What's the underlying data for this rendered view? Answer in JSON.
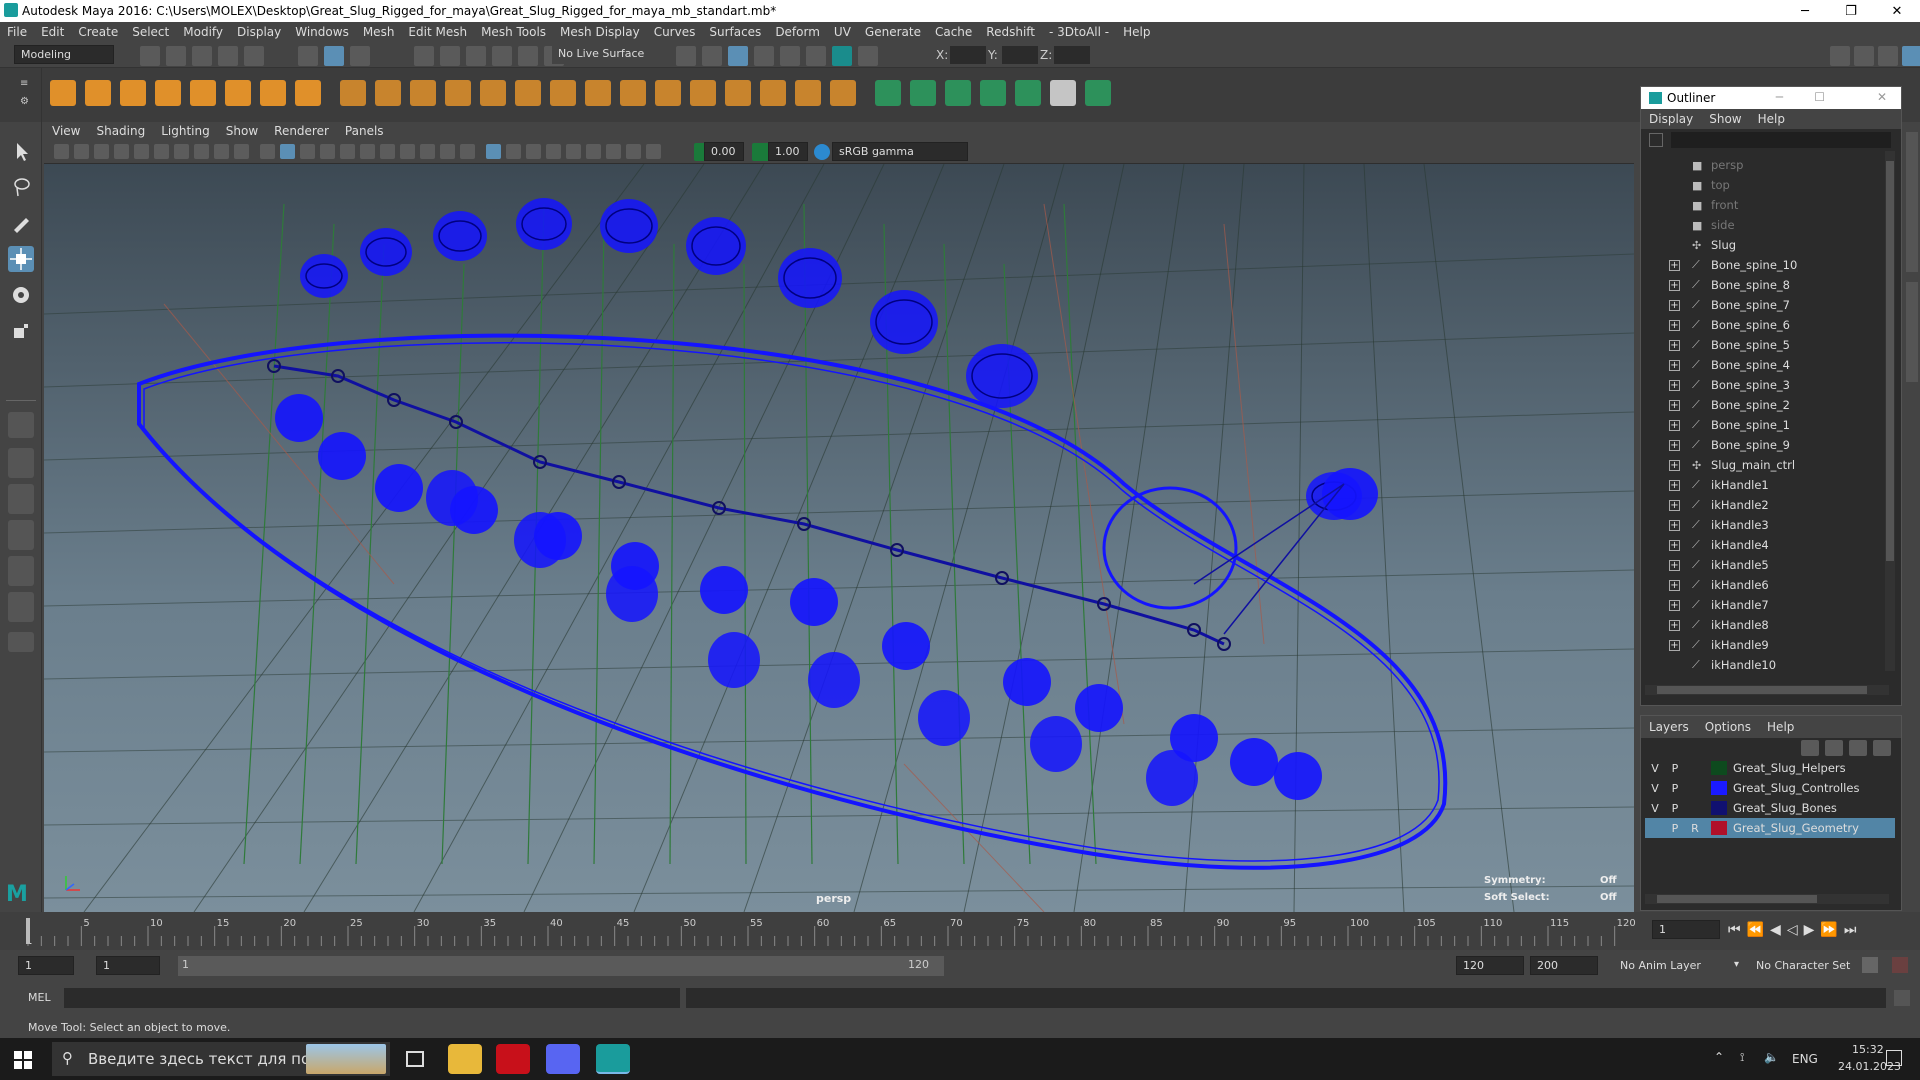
{
  "window": {
    "title": "Autodesk Maya 2016: C:\\Users\\MOLEX\\Desktop\\Great_Slug_Rigged_for_maya\\Great_Slug_Rigged_for_maya_mb_standart.mb*"
  },
  "menubar": [
    "File",
    "Edit",
    "Create",
    "Select",
    "Modify",
    "Display",
    "Windows",
    "Mesh",
    "Edit Mesh",
    "Mesh Tools",
    "Mesh Display",
    "Curves",
    "Surfaces",
    "Deform",
    "UV",
    "Generate",
    "Cache",
    "Redshift",
    "- 3DtoAll -",
    "Help"
  ],
  "statusline": {
    "mode": "Modeling",
    "live_surface": "No Live Surface",
    "x_label": "X:",
    "y_label": "Y:",
    "z_label": "Z:"
  },
  "viewport": {
    "menu": [
      "View",
      "Shading",
      "Lighting",
      "Show",
      "Renderer",
      "Panels"
    ],
    "near": "0.00",
    "far": "1.00",
    "colorspace": "sRGB gamma",
    "camera": "persp",
    "hud": [
      {
        "label": "Symmetry:",
        "value": "Off"
      },
      {
        "label": "Soft Select:",
        "value": "Off"
      }
    ],
    "wire_color": "#1414ff"
  },
  "outliner": {
    "title": "Outliner",
    "menu": [
      "Display",
      "Show",
      "Help"
    ],
    "items": [
      {
        "label": "persp",
        "icon": "camera-icon",
        "expand": false,
        "dim": true
      },
      {
        "label": "top",
        "icon": "camera-icon",
        "expand": false,
        "dim": true
      },
      {
        "label": "front",
        "icon": "camera-icon",
        "expand": false,
        "dim": true
      },
      {
        "label": "side",
        "icon": "camera-icon",
        "expand": false,
        "dim": true
      },
      {
        "label": "Slug",
        "icon": "transform-icon",
        "expand": false,
        "dim": false
      },
      {
        "label": "Bone_spine_10",
        "icon": "joint-icon",
        "expand": true,
        "dim": false
      },
      {
        "label": "Bone_spine_8",
        "icon": "joint-icon",
        "expand": true,
        "dim": false
      },
      {
        "label": "Bone_spine_7",
        "icon": "joint-icon",
        "expand": true,
        "dim": false
      },
      {
        "label": "Bone_spine_6",
        "icon": "joint-icon",
        "expand": true,
        "dim": false
      },
      {
        "label": "Bone_spine_5",
        "icon": "joint-icon",
        "expand": true,
        "dim": false
      },
      {
        "label": "Bone_spine_4",
        "icon": "joint-icon",
        "expand": true,
        "dim": false
      },
      {
        "label": "Bone_spine_3",
        "icon": "joint-icon",
        "expand": true,
        "dim": false
      },
      {
        "label": "Bone_spine_2",
        "icon": "joint-icon",
        "expand": true,
        "dim": false
      },
      {
        "label": "Bone_spine_1",
        "icon": "joint-icon",
        "expand": true,
        "dim": false
      },
      {
        "label": "Bone_spine_9",
        "icon": "joint-icon",
        "expand": true,
        "dim": false
      },
      {
        "label": "Slug_main_ctrl",
        "icon": "transform-icon",
        "expand": true,
        "dim": false
      },
      {
        "label": "ikHandle1",
        "icon": "ik-icon",
        "expand": true,
        "dim": false
      },
      {
        "label": "ikHandle2",
        "icon": "ik-icon",
        "expand": true,
        "dim": false
      },
      {
        "label": "ikHandle3",
        "icon": "ik-icon",
        "expand": true,
        "dim": false
      },
      {
        "label": "ikHandle4",
        "icon": "ik-icon",
        "expand": true,
        "dim": false
      },
      {
        "label": "ikHandle5",
        "icon": "ik-icon",
        "expand": true,
        "dim": false
      },
      {
        "label": "ikHandle6",
        "icon": "ik-icon",
        "expand": true,
        "dim": false
      },
      {
        "label": "ikHandle7",
        "icon": "ik-icon",
        "expand": true,
        "dim": false
      },
      {
        "label": "ikHandle8",
        "icon": "ik-icon",
        "expand": true,
        "dim": false
      },
      {
        "label": "ikHandle9",
        "icon": "ik-icon",
        "expand": true,
        "dim": false
      },
      {
        "label": "ikHandle10",
        "icon": "ik-icon",
        "expand": false,
        "dim": false
      }
    ]
  },
  "layers": {
    "menu": [
      "Layers",
      "Options",
      "Help"
    ],
    "rows": [
      {
        "v": "V",
        "p": "P",
        "r": "",
        "name": "Great_Slug_Helpers",
        "color": "#0d4a1e",
        "selected": false
      },
      {
        "v": "V",
        "p": "P",
        "r": "",
        "name": "Great_Slug_Controlles",
        "color": "#1a1aff",
        "selected": false
      },
      {
        "v": "V",
        "p": "P",
        "r": "",
        "name": "Great_Slug_Bones",
        "color": "#101070",
        "selected": false
      },
      {
        "v": "",
        "p": "P",
        "r": "R",
        "name": "Great_Slug_Geometry",
        "color": "#b0102a",
        "selected": true
      }
    ]
  },
  "timeline": {
    "ticks": [
      "5",
      "10",
      "15",
      "20",
      "25",
      "30",
      "35",
      "40",
      "45",
      "50",
      "55",
      "60",
      "65",
      "70",
      "75",
      "80",
      "85",
      "90",
      "95",
      "100",
      "105",
      "110",
      "115",
      "120"
    ],
    "start_tick": "1",
    "current_frame": "1"
  },
  "range": {
    "start": "1",
    "start2": "1",
    "slider_start": "1",
    "slider_end": "120",
    "end": "120",
    "end2": "200",
    "anim_layer": "No Anim Layer",
    "char_set": "No Character Set"
  },
  "cmdline": {
    "label": "MEL"
  },
  "helpline": {
    "text": "Move Tool: Select an object to move."
  },
  "taskbar": {
    "search_placeholder": "Введите здесь текст для поиска",
    "lang": "ENG",
    "time": "15:32",
    "date": "24.01.2023"
  }
}
